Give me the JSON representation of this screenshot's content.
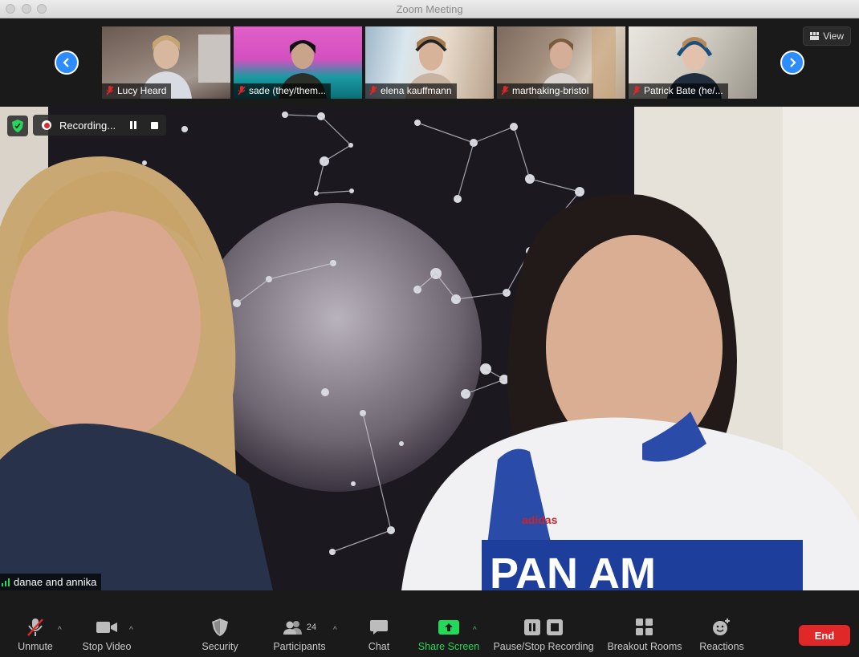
{
  "window": {
    "title": "Zoom Meeting"
  },
  "gallery": {
    "view_label": "View",
    "participants": [
      {
        "name": "Lucy Heard"
      },
      {
        "name": "sade (they/them..."
      },
      {
        "name": "elena kauffmann"
      },
      {
        "name": "marthaking-bristol"
      },
      {
        "name": "Patrick Bate (he/..."
      }
    ]
  },
  "main_video": {
    "speaker_name": "danae and annika",
    "recording_label": "Recording..."
  },
  "toolbar": {
    "unmute": "Unmute",
    "stop_video": "Stop Video",
    "security": "Security",
    "participants": "Participants",
    "participant_count": "24",
    "chat": "Chat",
    "share_screen": "Share Screen",
    "pause_stop_recording": "Pause/Stop Recording",
    "breakout_rooms": "Breakout Rooms",
    "reactions": "Reactions",
    "end": "End"
  },
  "colors": {
    "accent": "#2d8cff",
    "share": "#23d959",
    "end": "#e02828"
  }
}
